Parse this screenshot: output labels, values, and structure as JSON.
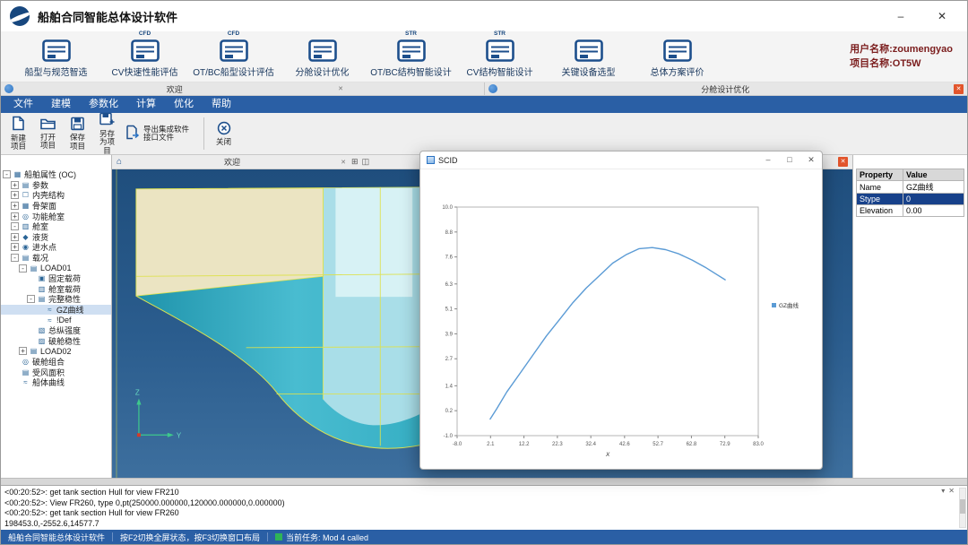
{
  "colors": {
    "accent_navy": "#17477e",
    "menubar_blue": "#2a5fa5",
    "project_text_red": "#7b1d1d",
    "viewport_blue_top": "#1f4e7d",
    "viewport_blue_bottom": "#3d6f9e",
    "hull_teal": "#35aec3",
    "hull_light": "#a9dee8",
    "deck_cream": "#ebe4c2",
    "wireframe_yellow": "#dde24e",
    "curve_blue": "#5b9bd5",
    "selected_row_blue": "#17418a",
    "close_button_red": "#e2552c",
    "task_green": "#2fb457"
  },
  "titlebar": {
    "title": "船舶合同智能总体设计软件",
    "minimize": "–",
    "close": "✕"
  },
  "ribbon": {
    "items": [
      {
        "id": "ship-select",
        "label": "船型与规范智选",
        "badge": ""
      },
      {
        "id": "cv-speed-eval",
        "label": "CV快速性能评估",
        "badge": "CFD"
      },
      {
        "id": "otbc-hull-eval",
        "label": "OT/BC船型设计评估",
        "badge": "CFD"
      },
      {
        "id": "subdivision-opt",
        "label": "分舱设计优化",
        "badge": ""
      },
      {
        "id": "otbc-structure",
        "label": "OT/BC结构智能设计",
        "badge": "STR"
      },
      {
        "id": "cv-structure",
        "label": "CV结构智能设计",
        "badge": "STR"
      },
      {
        "id": "equipment-select",
        "label": "关键设备选型",
        "badge": ""
      },
      {
        "id": "overall-eval",
        "label": "总体方案评价",
        "badge": ""
      }
    ],
    "user_name": "用户名称:zoumengyao",
    "project_name": "项目名称:OT5W"
  },
  "tabstrip": {
    "left": {
      "label": "欢迎",
      "close": "✕"
    },
    "right": {
      "label": "分舱设计优化",
      "close": "✕"
    }
  },
  "menubar": {
    "items": [
      "文件",
      "建模",
      "参数化",
      "计算",
      "优化",
      "帮助"
    ]
  },
  "toolbar": {
    "items": [
      {
        "id": "new-project",
        "label": "新建项目",
        "icon": "new"
      },
      {
        "id": "open-project",
        "label": "打开项目",
        "icon": "open"
      },
      {
        "id": "save-project",
        "label": "保存项目",
        "icon": "save"
      },
      {
        "id": "save-as-project",
        "label": "另存为项目",
        "icon": "saveas"
      },
      {
        "id": "export-interface",
        "label": "导出集成软件接口文件",
        "icon": "export",
        "wide": true
      },
      {
        "id": "close",
        "label": "关闭",
        "icon": "close",
        "sep_before": true
      }
    ]
  },
  "tree": {
    "items": [
      {
        "depth": 0,
        "exp": "-",
        "icon": "root",
        "label": "船舶属性 (OC)"
      },
      {
        "depth": 1,
        "exp": "+",
        "icon": "param",
        "label": "参数"
      },
      {
        "depth": 1,
        "exp": "+",
        "icon": "shell",
        "label": "内壳结构"
      },
      {
        "depth": 1,
        "exp": "+",
        "icon": "frame",
        "label": "骨架面"
      },
      {
        "depth": 1,
        "exp": "+",
        "icon": "funcroom",
        "label": "功能舱室"
      },
      {
        "depth": 1,
        "exp": "-",
        "icon": "room",
        "label": "舱室"
      },
      {
        "depth": 1,
        "exp": "+",
        "icon": "cargo",
        "label": "液货"
      },
      {
        "depth": 1,
        "exp": "+",
        "icon": "floodpoint",
        "label": "进水点"
      },
      {
        "depth": 1,
        "exp": "-",
        "icon": "loadcase",
        "label": "载况"
      },
      {
        "depth": 2,
        "exp": "-",
        "icon": "loadcase",
        "label": "LOAD01"
      },
      {
        "depth": 3,
        "exp": "",
        "icon": "fixedload",
        "label": "固定载荷"
      },
      {
        "depth": 3,
        "exp": "",
        "icon": "roomload",
        "label": "舱室载荷"
      },
      {
        "depth": 3,
        "exp": "-",
        "icon": "stability",
        "label": "完整稳性"
      },
      {
        "depth": 4,
        "exp": "",
        "icon": "curve",
        "label": "GZ曲线",
        "selected": true
      },
      {
        "depth": 4,
        "exp": "",
        "icon": "curve",
        "label": "!Def"
      },
      {
        "depth": 3,
        "exp": "",
        "icon": "strength",
        "label": "总纵强度"
      },
      {
        "depth": 3,
        "exp": "",
        "icon": "damage",
        "label": "破舱稳性"
      },
      {
        "depth": 2,
        "exp": "+",
        "icon": "loadcase",
        "label": "LOAD02"
      },
      {
        "depth": 1,
        "exp": "",
        "icon": "combo",
        "label": "破舱组合"
      },
      {
        "depth": 1,
        "exp": "",
        "icon": "wind",
        "label": "受风面积"
      },
      {
        "depth": 1,
        "exp": "",
        "icon": "hullcurve",
        "label": "船体曲线"
      }
    ]
  },
  "viewport": {
    "tab_label": "欢迎",
    "tab_close": "✕",
    "home_icon": "⌂",
    "grid_icon": "⊞",
    "split_icon": "◫",
    "panel_close": "✕",
    "axis_z": "Z",
    "axis_y": "Y"
  },
  "scid": {
    "title": "SCID",
    "minimize": "–",
    "maximize": "□",
    "close": "✕"
  },
  "chart_data": {
    "type": "line",
    "title": "",
    "xlabel": "X",
    "ylabel": "",
    "xlim": [
      -8.0,
      83.0
    ],
    "ylim": [
      -1.0,
      10.0
    ],
    "xticks": [
      "-8.0",
      "2.1",
      "12.2",
      "22.3",
      "32.4",
      "42.6",
      "52.7",
      "62.8",
      "72.9",
      "83.0"
    ],
    "yticks": [
      "-1.0",
      "0.2",
      "1.4",
      "2.7",
      "3.9",
      "5.1",
      "6.3",
      "7.6",
      "8.8",
      "10.0"
    ],
    "grid": false,
    "legend_position": "right",
    "series": [
      {
        "name": "GZ曲线",
        "color": "#5b9bd5",
        "x": [
          2,
          4,
          7,
          11,
          15,
          19,
          23,
          27,
          31,
          35,
          39,
          43,
          47,
          51,
          55,
          59,
          63,
          67,
          70,
          73
        ],
        "y": [
          -0.2,
          0.3,
          1.1,
          2.0,
          2.9,
          3.8,
          4.6,
          5.4,
          6.1,
          6.7,
          7.3,
          7.7,
          8.0,
          8.05,
          7.95,
          7.75,
          7.45,
          7.1,
          6.8,
          6.5
        ]
      }
    ]
  },
  "properties": {
    "header_property": "Property",
    "header_value": "Value",
    "rows": [
      {
        "name": "Name",
        "value": "GZ曲线",
        "selected": false
      },
      {
        "name": "Stype",
        "value": "0",
        "selected": true
      },
      {
        "name": "Elevation",
        "value": "0.00",
        "selected": false
      }
    ]
  },
  "log": {
    "lines": [
      "<00:20:52>: get tank section Hull for view FR210",
      "<00:20:52>: View FR260, type 0,pt(250000.000000,120000.000000,0.000000)",
      "<00:20:52>: get tank section Hull for view FR260",
      "198453.0,-2552.6,14577.7"
    ],
    "collapse_icon": "▾",
    "close_icon": "✕"
  },
  "statusbar": {
    "app": "船舶合同智能总体设计软件",
    "hint": "按F2切换全屏状态，按F3切换窗口布局",
    "task": "当前任务: Mod 4 called"
  }
}
